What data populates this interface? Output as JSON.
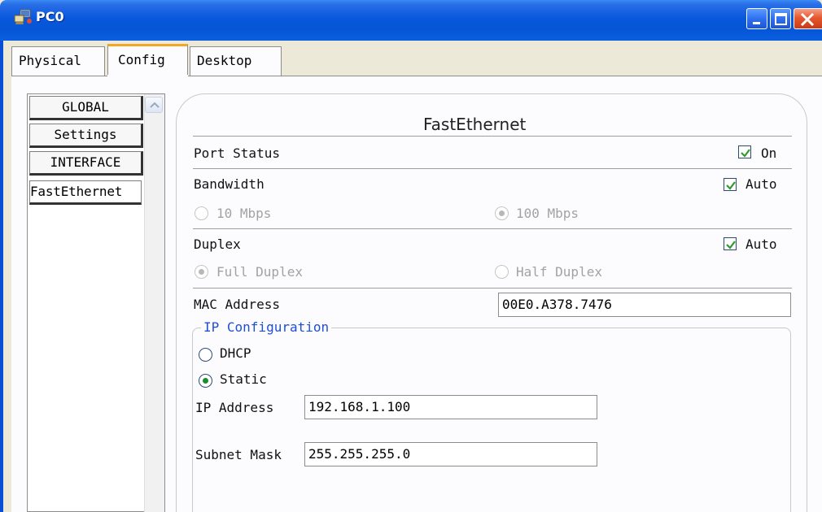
{
  "window": {
    "title": "PC0",
    "controls": [
      "minimize-icon",
      "maximize-icon",
      "close-icon"
    ]
  },
  "tabs": [
    {
      "label": "Physical",
      "selected": false
    },
    {
      "label": "Config",
      "selected": true
    },
    {
      "label": "Desktop",
      "selected": false
    }
  ],
  "sidebar": {
    "items": [
      {
        "label": "GLOBAL"
      },
      {
        "label": "Settings"
      },
      {
        "label": "INTERFACE"
      },
      {
        "label": "FastEthernet",
        "selected": true
      }
    ]
  },
  "interface": {
    "title": "FastEthernet",
    "port_status": {
      "label": "Port Status",
      "checkbox_label": "On",
      "checked": true
    },
    "bandwidth": {
      "label": "Bandwidth",
      "checkbox_label": "Auto",
      "checked": true,
      "options": [
        {
          "label": "10 Mbps",
          "selected": false
        },
        {
          "label": "100 Mbps",
          "selected": true
        }
      ]
    },
    "duplex": {
      "label": "Duplex",
      "checkbox_label": "Auto",
      "checked": true,
      "options": [
        {
          "label": "Full Duplex",
          "selected": true
        },
        {
          "label": "Half Duplex",
          "selected": false
        }
      ]
    },
    "mac": {
      "label": "MAC Address",
      "value": "00E0.A378.7476"
    },
    "ip_config": {
      "title": "IP Configuration",
      "dhcp": {
        "label": "DHCP",
        "selected": false
      },
      "static": {
        "label": "Static",
        "selected": true
      },
      "ip_address": {
        "label": "IP Address",
        "value": "192.168.1.100"
      },
      "subnet_mask": {
        "label": "Subnet Mask",
        "value": "255.255.255.0"
      }
    }
  },
  "colors": {
    "titlebar": "#0858de",
    "tab_highlight": "#f5a623",
    "group_title": "#1d4fd8",
    "radio_selected": "#1d8a2c"
  }
}
